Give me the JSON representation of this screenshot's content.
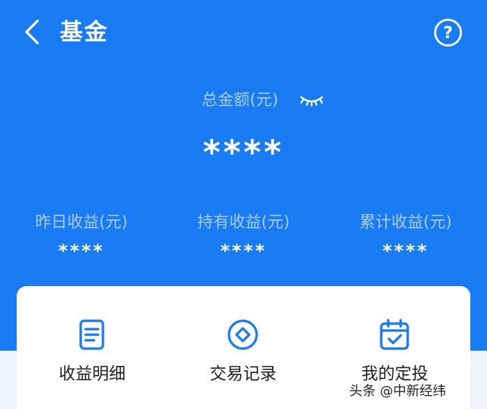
{
  "header": {
    "title": "基金",
    "back_icon": "chevron-left-icon",
    "help_icon": "question-circle-icon",
    "help_glyph": "?"
  },
  "summary": {
    "total_label": "总金额(元)",
    "total_value": "****",
    "visibility_icon": "eye-closed-icon"
  },
  "stats": [
    {
      "label": "昨日收益(元)",
      "value": "****"
    },
    {
      "label": "持有收益(元)",
      "value": "****"
    },
    {
      "label": "累计收益(元)",
      "value": "****"
    }
  ],
  "actions": [
    {
      "label": "收益明细",
      "icon": "document-icon"
    },
    {
      "label": "交易记录",
      "icon": "diamond-circle-icon"
    },
    {
      "label": "我的定投",
      "icon": "calendar-check-icon"
    }
  ],
  "watermark": "头条 @中新经纬",
  "colors": {
    "brand_blue": "#1a7cf5",
    "muted_label": "#a9ccfb",
    "icon_blue": "#1a7cf5"
  }
}
